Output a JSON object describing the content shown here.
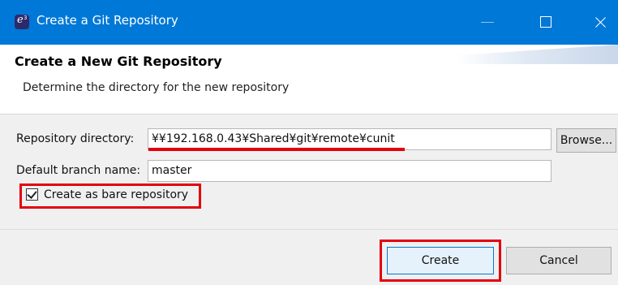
{
  "window": {
    "title": "Create a Git Repository",
    "icon": "eclipse-app-icon"
  },
  "header": {
    "title": "Create a New Git Repository",
    "description": "Determine the directory for the new repository"
  },
  "form": {
    "repo_dir_label": "Repository directory:",
    "repo_dir_value": "¥¥192.168.0.43¥Shared¥git¥remote¥cunit",
    "browse_label": "Browse...",
    "branch_label": "Default branch name:",
    "branch_value": "master",
    "bare_checkbox_label": "Create as bare repository",
    "bare_checked": true
  },
  "buttons": {
    "create_label": "Create",
    "cancel_label": "Cancel"
  },
  "colors": {
    "titlebar": "#0078d7",
    "highlight": "#e3000f"
  }
}
